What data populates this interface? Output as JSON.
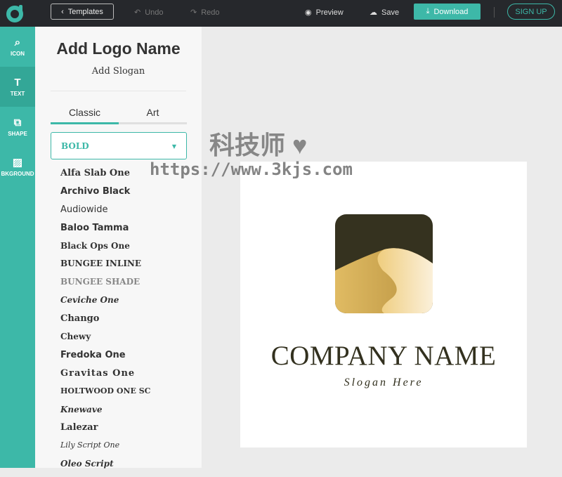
{
  "topbar": {
    "templates": "Templates",
    "undo": "Undo",
    "redo": "Redo",
    "preview": "Preview",
    "save": "Save",
    "download": "Download",
    "signup": "SIGN UP"
  },
  "rail": [
    {
      "label": "ICON",
      "icon": "search-icon"
    },
    {
      "label": "TEXT",
      "icon": "text-icon"
    },
    {
      "label": "SHAPE",
      "icon": "shape-icon"
    },
    {
      "label": "BKGROUND",
      "icon": "background-icon"
    }
  ],
  "panel": {
    "title": "Add Logo Name",
    "slogan": "Add Slogan",
    "tabs": [
      "Classic",
      "Art"
    ],
    "select": "BOLD",
    "fonts": [
      "Alfa Slab One",
      "Archivo Black",
      "Audiowide",
      "Baloo Tamma",
      "Black Ops One",
      "BUNGEE INLINE",
      "BUNGEE SHADE",
      "Ceviche One",
      "Chango",
      "Chewy",
      "Fredoka One",
      "Gravitas One",
      "HOLTWOOD ONE SC",
      "Knewave",
      "Lalezar",
      "Lily Script One",
      "Oleo Script"
    ]
  },
  "canvas": {
    "company": "COMPANY NAME",
    "slogan": "Slogan Here"
  },
  "watermark": {
    "text": "科技师",
    "url": "https://www.3kjs.com"
  },
  "colors": {
    "accent": "#3db8a8",
    "topbar": "#26282c",
    "logo_dark": "#35321f",
    "logo_gold": "#d9b35c"
  }
}
